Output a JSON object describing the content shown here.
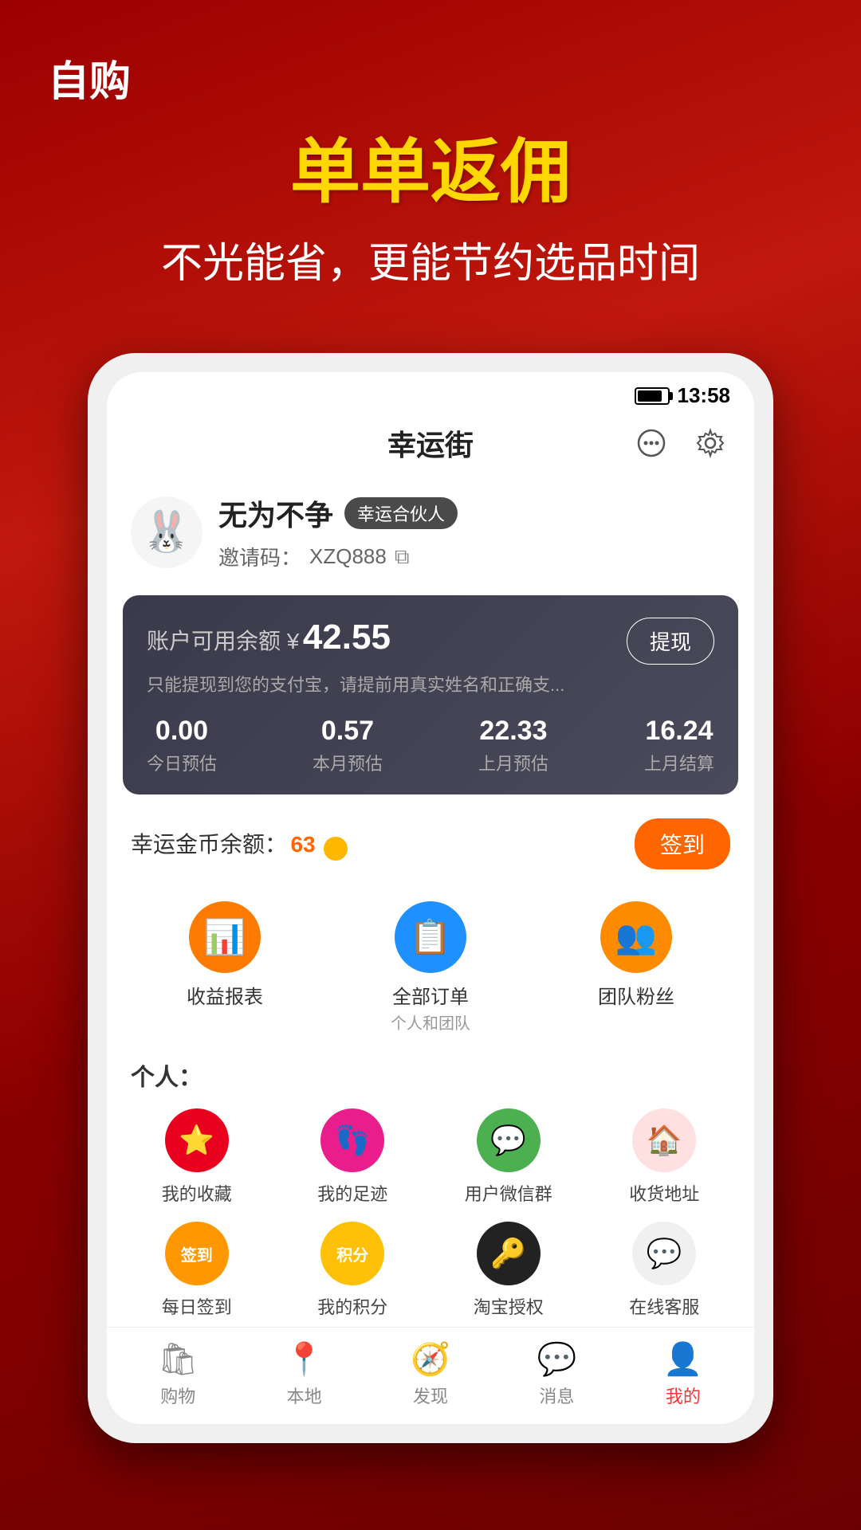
{
  "page": {
    "bg_top_label": "自购",
    "headline": "单单返佣",
    "subheadline": "不光能省，更能节约选品时间"
  },
  "status_bar": {
    "time": "13:58",
    "battery_label": "battery"
  },
  "app_header": {
    "title": "幸运街"
  },
  "user": {
    "name": "无为不争",
    "badge": "幸运合伙人",
    "invite_label": "邀请码：",
    "invite_code": "XZQ888"
  },
  "balance_card": {
    "label": "账户可用余额 ¥",
    "amount": "42.55",
    "desc": "只能提现到您的支付宝，请提前用真实姓名和正确支...",
    "withdraw_btn": "提现",
    "stats": [
      {
        "value": "0.00",
        "label": "今日预估"
      },
      {
        "value": "0.57",
        "label": "本月预估"
      },
      {
        "value": "22.33",
        "label": "上月预估"
      },
      {
        "value": "16.24",
        "label": "上月结算"
      }
    ]
  },
  "gold_section": {
    "label": "幸运金币余额：",
    "amount": "63",
    "sign_btn": "签到"
  },
  "quick_menu": [
    {
      "id": "income-report",
      "label": "收益报表",
      "sublabel": "",
      "icon": "📊",
      "color": "orange"
    },
    {
      "id": "all-orders",
      "label": "全部订单",
      "sublabel": "个人和团队",
      "icon": "📋",
      "color": "blue"
    },
    {
      "id": "team-fans",
      "label": "团队粉丝",
      "sublabel": "",
      "icon": "👥",
      "color": "amber"
    }
  ],
  "personal_section": {
    "header": "个人：",
    "items": [
      {
        "id": "my-collection",
        "label": "我的收藏",
        "icon": "⭐",
        "color": "red"
      },
      {
        "id": "my-footprint",
        "label": "我的足迹",
        "icon": "👣",
        "color": "pink"
      },
      {
        "id": "wechat-group",
        "label": "用户微信群",
        "icon": "💬",
        "color": "green"
      },
      {
        "id": "shipping-address",
        "label": "收货地址",
        "icon": "🏠",
        "color": "house"
      },
      {
        "id": "daily-sign",
        "label": "每日签到",
        "icon": "签到",
        "color": "orange-bg"
      },
      {
        "id": "my-points",
        "label": "我的积分",
        "icon": "积分",
        "color": "yellow-bg"
      },
      {
        "id": "taobao-auth",
        "label": "淘宝授权",
        "icon": "🔑",
        "color": "dark"
      },
      {
        "id": "online-service",
        "label": "在线客服",
        "icon": "💬",
        "color": "gray"
      }
    ]
  },
  "bottom_nav": [
    {
      "id": "shop",
      "label": "购物",
      "icon": "🛍",
      "active": false
    },
    {
      "id": "local",
      "label": "本地",
      "icon": "📍",
      "active": false
    },
    {
      "id": "discover",
      "label": "发现",
      "icon": "🧭",
      "active": false
    },
    {
      "id": "messages",
      "label": "消息",
      "icon": "💬",
      "active": false
    },
    {
      "id": "mine",
      "label": "我的",
      "icon": "👤",
      "active": true
    }
  ]
}
